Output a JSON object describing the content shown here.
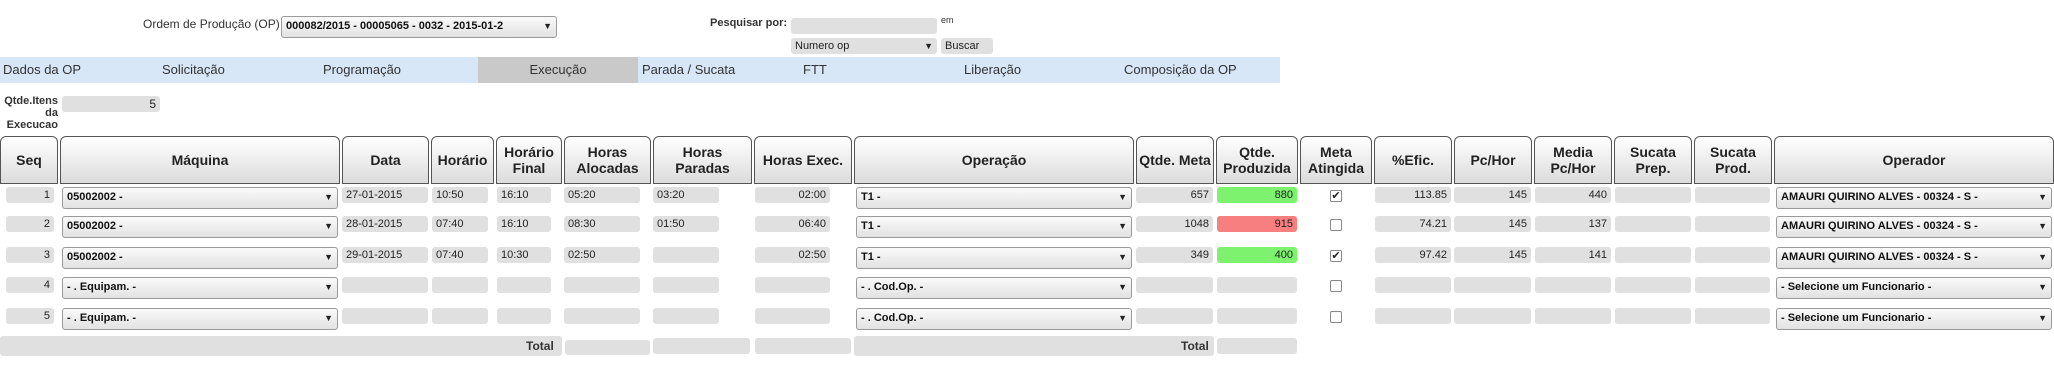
{
  "top": {
    "op_label": "Ordem de Produção (OP)",
    "op_value": "000082/2015 - 00005065 - 0032 - 2015-01-2",
    "search_label": "Pesquisar por:",
    "search_value": "",
    "em_label": "em",
    "search_field_value": "Numero op",
    "search_button": "Buscar"
  },
  "tabs": [
    "Dados da OP",
    "Solicitação",
    "Programação",
    "Execução",
    "Parada / Sucata",
    "FTT",
    "Liberação",
    "Composição da OP"
  ],
  "qtde": {
    "label": "Qtde.Itens da Execucao",
    "value": "5"
  },
  "headers": {
    "seq": "Seq",
    "maquina": "Máquina",
    "data": "Data",
    "horario": "Horário",
    "horario_final": "Horário Final",
    "horas_alocadas": "Horas Alocadas",
    "horas_paradas": "Horas Paradas",
    "horas_exec": "Horas Exec.",
    "operacao": "Operação",
    "qtde_meta": "Qtde. Meta",
    "qtde_produzida": "Qtde. Produzida",
    "meta_atingida": "Meta Atingida",
    "efic": "%Efic.",
    "pc_hor": "Pc/Hor",
    "media_pc_hor": "Media Pc/Hor",
    "sucata_prep": "Sucata Prep.",
    "sucata_prod": "Sucata Prod.",
    "operador": "Operador"
  },
  "rows": [
    {
      "seq": "1",
      "maquina": "05002002 -",
      "data": "27-01-2015",
      "horario": "10:50",
      "horario_final": "16:10",
      "horas_alocadas": "05:20",
      "horas_paradas": "03:20",
      "horas_exec": "02:00",
      "operacao": "T1 -",
      "qtde_meta": "657",
      "qtde_produzida": "880",
      "produzida_status": "ok",
      "meta_atingida": true,
      "efic": "113.85",
      "pc_hor": "145",
      "media_pc_hor": "440",
      "sucata_prep": "",
      "sucata_prod": "",
      "operador": "AMAURI QUIRINO ALVES - 00324 - S -"
    },
    {
      "seq": "2",
      "maquina": "05002002 -",
      "data": "28-01-2015",
      "horario": "07:40",
      "horario_final": "16:10",
      "horas_alocadas": "08:30",
      "horas_paradas": "01:50",
      "horas_exec": "06:40",
      "operacao": "T1 -",
      "qtde_meta": "1048",
      "qtde_produzida": "915",
      "produzida_status": "bad",
      "meta_atingida": false,
      "efic": "74.21",
      "pc_hor": "145",
      "media_pc_hor": "137",
      "sucata_prep": "",
      "sucata_prod": "",
      "operador": "AMAURI QUIRINO ALVES - 00324 - S -"
    },
    {
      "seq": "3",
      "maquina": "05002002 -",
      "data": "29-01-2015",
      "horario": "07:40",
      "horario_final": "10:30",
      "horas_alocadas": "02:50",
      "horas_paradas": "",
      "horas_exec": "02:50",
      "operacao": "T1 -",
      "qtde_meta": "349",
      "qtde_produzida": "400",
      "produzida_status": "ok",
      "meta_atingida": true,
      "efic": "97.42",
      "pc_hor": "145",
      "media_pc_hor": "141",
      "sucata_prep": "",
      "sucata_prod": "",
      "operador": "AMAURI QUIRINO ALVES - 00324 - S -"
    },
    {
      "seq": "4",
      "maquina": "- . Equipam. -",
      "data": "",
      "horario": "",
      "horario_final": "",
      "horas_alocadas": "",
      "horas_paradas": "",
      "horas_exec": "",
      "operacao": "- . Cod.Op. -",
      "qtde_meta": "",
      "qtde_produzida": "",
      "produzida_status": "none",
      "meta_atingida": false,
      "efic": "",
      "pc_hor": "",
      "media_pc_hor": "",
      "sucata_prep": "",
      "sucata_prod": "",
      "operador": "- Selecione um Funcionario -"
    },
    {
      "seq": "5",
      "maquina": "- . Equipam. -",
      "data": "",
      "horario": "",
      "horario_final": "",
      "horas_alocadas": "",
      "horas_paradas": "",
      "horas_exec": "",
      "operacao": "- . Cod.Op. -",
      "qtde_meta": "",
      "qtde_produzida": "",
      "produzida_status": "none",
      "meta_atingida": false,
      "efic": "",
      "pc_hor": "",
      "media_pc_hor": "",
      "sucata_prep": "",
      "sucata_prod": "",
      "operador": "- Selecione um Funcionario -"
    }
  ],
  "totals": {
    "label1": "Total",
    "label2": "Total"
  },
  "colors": {
    "tab_bg": "#d7e7f7",
    "active_tab": "#c9c9c9",
    "ok": "#7df26f",
    "bad": "#f77f7f",
    "field": "#e0e0e0"
  },
  "icons": {
    "dropdown": "chevron-down-icon",
    "check": "checkmark-icon"
  }
}
